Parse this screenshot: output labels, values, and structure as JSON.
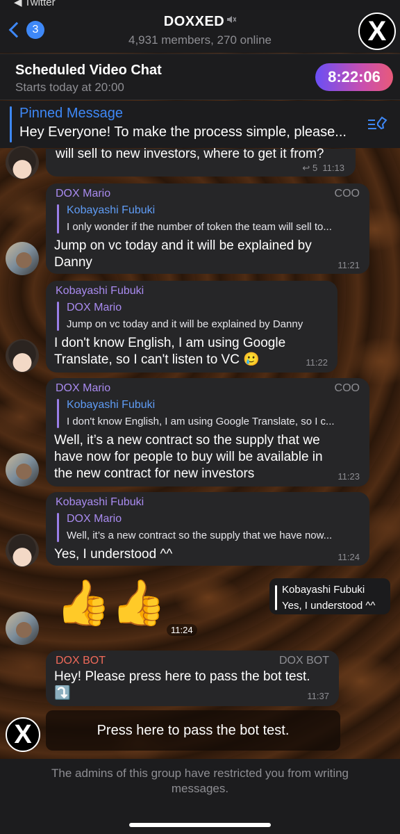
{
  "statusbar": {
    "label": "◀ Twitter"
  },
  "header": {
    "back_badge": "3",
    "title": "DOXXED",
    "mute_icon": "🔇",
    "subtitle": "4,931 members, 270 online",
    "logo": "X"
  },
  "video_chat": {
    "title": "Scheduled Video Chat",
    "subtitle": "Starts today at 20:00",
    "timer": "8:22:06"
  },
  "pinned": {
    "title": "Pinned Message",
    "text": "Hey Everyone! To make the process simple, please..."
  },
  "messages": [
    {
      "text": "will sell to new investors, where to get it from?",
      "replies": "5",
      "time": "11:13"
    },
    {
      "sender": "DOX Mario",
      "role": "COO",
      "reply_name": "Kobayashi Fubuki",
      "reply_text": "I only wonder if the number of token the team will sell to...",
      "text_lines": [
        "Jump on vc today and it will be explained by",
        "Danny"
      ],
      "time": "11:21"
    },
    {
      "sender": "Kobayashi Fubuki",
      "reply_name": "DOX Mario",
      "reply_text": "Jump on vc today and it will be explained by Danny",
      "text_lines": [
        "I don't know English, I am using Google",
        "Translate, so I can't listen to VC 🥲"
      ],
      "time": "11:22"
    },
    {
      "sender": "DOX Mario",
      "role": "COO",
      "reply_name": "Kobayashi Fubuki",
      "reply_text": "I don't know English, I am using Google Translate, so I c...",
      "text_lines": [
        "Well, it’s a new contract so the supply that we",
        "have now for people to buy will be available in",
        "the new contract for new investors"
      ],
      "time": "11:23"
    },
    {
      "sender": "Kobayashi Fubuki",
      "reply_name": "DOX Mario",
      "reply_text": "Well, it’s a new contract so the supply that we have now...",
      "text_lines": [
        "Yes, I understood ^^"
      ],
      "time": "11:24"
    },
    {
      "sticker": "👍👍",
      "time": "11:24",
      "quote_name": "Kobayashi Fubuki",
      "quote_text": "Yes, I understood ^^"
    },
    {
      "sender": "DOX BOT",
      "role": "DOX BOT",
      "text_lines": [
        "Hey! Please press here to pass the bot test.",
        "⤵️"
      ],
      "time": "11:37"
    }
  ],
  "bot_button": "Press here to pass the bot test.",
  "restricted": "The admins of this group have restricted you from writing messages."
}
